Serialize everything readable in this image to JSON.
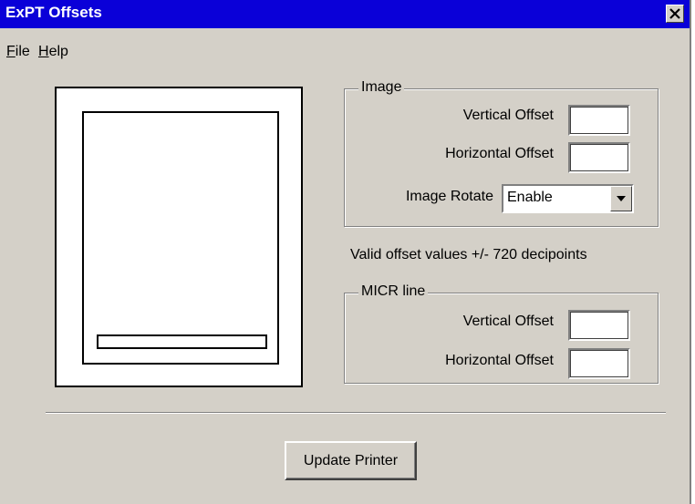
{
  "window": {
    "title": "ExPT Offsets"
  },
  "menu": {
    "file": "File",
    "file_key": "F",
    "file_rest": "ile",
    "help": "Help",
    "help_key": "H",
    "help_rest": "elp"
  },
  "image_group": {
    "label": "Image",
    "vertical_offset_label": "Vertical Offset",
    "vertical_offset_value": "",
    "horizontal_offset_label": "Horizontal Offset",
    "horizontal_offset_value": "",
    "rotate_label": "Image Rotate",
    "rotate_value": "Enable"
  },
  "note": "Valid offset values +/- 720 decipoints",
  "micr_group": {
    "label": "MICR line",
    "vertical_offset_label": "Vertical Offset",
    "vertical_offset_value": "",
    "horizontal_offset_label": "Horizontal Offset",
    "horizontal_offset_value": ""
  },
  "buttons": {
    "update": "Update Printer"
  },
  "icons": {
    "close": "close-icon",
    "dropdown": "chevron-down-icon"
  },
  "colors": {
    "titlebar": "#0a00d8",
    "window": "#d4d0c8"
  }
}
